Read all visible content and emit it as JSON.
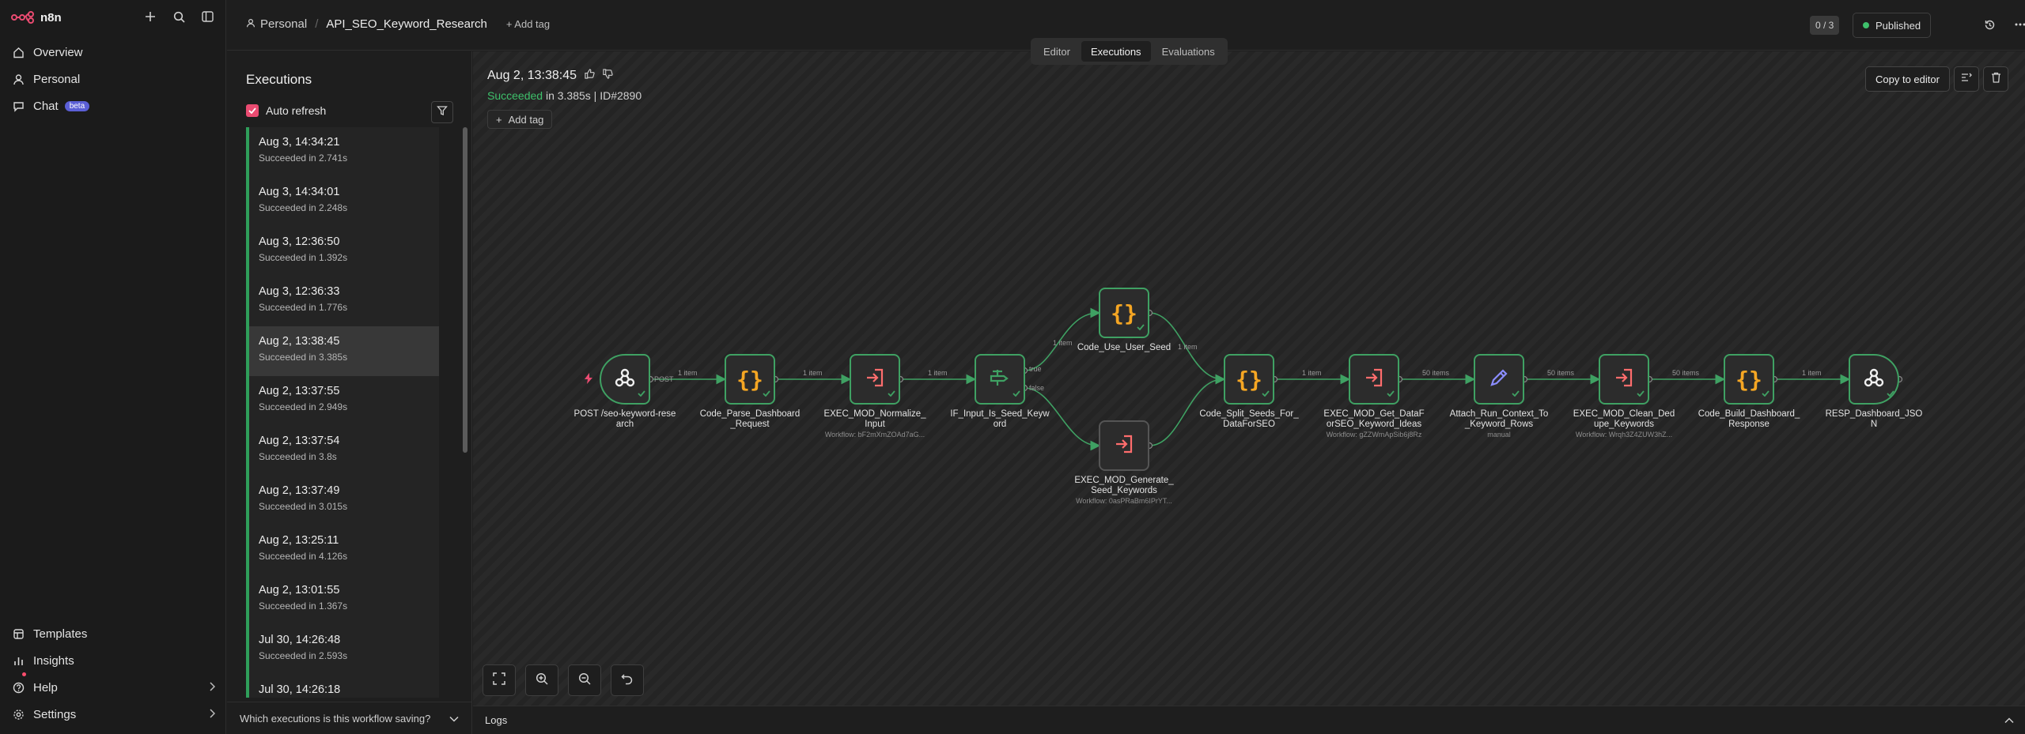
{
  "app": {
    "logo_text": "n8n"
  },
  "sidebar": {
    "top_icons": [
      "plus-icon",
      "search-icon",
      "panel-toggle-icon"
    ],
    "nav": [
      {
        "label": "Overview",
        "icon": "home-icon"
      },
      {
        "label": "Personal",
        "icon": "user-icon"
      },
      {
        "label": "Chat",
        "icon": "chat-icon",
        "badge": "beta"
      }
    ],
    "bottom": [
      {
        "label": "Templates",
        "icon": "templates-icon"
      },
      {
        "label": "Insights",
        "icon": "insights-icon"
      },
      {
        "label": "Help",
        "icon": "help-icon"
      },
      {
        "label": "Settings",
        "icon": "settings-icon"
      }
    ]
  },
  "header": {
    "project": "Personal",
    "workflow_name": "API_SEO_Keyword_Research",
    "add_tag": "+ Add tag",
    "tabs": [
      "Editor",
      "Executions",
      "Evaluations"
    ],
    "active_tab": "Executions",
    "counter": "0 / 3",
    "status": "Published",
    "status_color": "#3ec06b"
  },
  "executions": {
    "title": "Executions",
    "auto_refresh_label": "Auto refresh",
    "auto_refresh": true,
    "list": [
      {
        "date": "Aug 3, 14:34:21",
        "status": "Succeeded in 2.741s"
      },
      {
        "date": "Aug 3, 14:34:01",
        "status": "Succeeded in 2.248s"
      },
      {
        "date": "Aug 3, 12:36:50",
        "status": "Succeeded in 1.392s"
      },
      {
        "date": "Aug 3, 12:36:33",
        "status": "Succeeded in 1.776s"
      },
      {
        "date": "Aug 2, 13:38:45",
        "status": "Succeeded in 3.385s"
      },
      {
        "date": "Aug 2, 13:37:55",
        "status": "Succeeded in 2.949s"
      },
      {
        "date": "Aug 2, 13:37:54",
        "status": "Succeeded in 3.8s"
      },
      {
        "date": "Aug 2, 13:37:49",
        "status": "Succeeded in 3.015s"
      },
      {
        "date": "Aug 2, 13:25:11",
        "status": "Succeeded in 4.126s"
      },
      {
        "date": "Aug 2, 13:01:55",
        "status": "Succeeded in 1.367s"
      },
      {
        "date": "Jul 30, 14:26:48",
        "status": "Succeeded in 2.593s"
      },
      {
        "date": "Jul 30, 14:26:18",
        "status": ""
      }
    ],
    "active_index": 4,
    "saving_question": "Which executions is this workflow saving?"
  },
  "detail": {
    "date": "Aug 2, 13:38:45",
    "status_word": "Succeeded",
    "duration": " in 3.385s | ID#2890",
    "add_tag": "Add tag",
    "copy_button": "Copy to editor"
  },
  "nodes": [
    {
      "name": "POST /seo-keyword-research",
      "type": "webhook"
    },
    {
      "name": "Code_Parse_Dashboard_Request",
      "type": "code"
    },
    {
      "name": "EXEC_MOD_Normalize_Input",
      "type": "exec",
      "sub": "Workflow: bF2mXmZOAd7aG..."
    },
    {
      "name": "IF_Input_Is_Seed_Keyword",
      "type": "if"
    },
    {
      "name": "Code_Use_User_Seed",
      "type": "code"
    },
    {
      "name": "EXEC_MOD_Generate_Seed_Keywords",
      "type": "exec",
      "sub": "Workflow: 0asPRaBm6IPrYT..."
    },
    {
      "name": "Code_Split_Seeds_For_DataForSEO",
      "type": "code"
    },
    {
      "name": "EXEC_MOD_Get_DataForSEO_Keyword_Ideas",
      "type": "exec",
      "sub": "Workflow: gZZWmApSib6j8Rz"
    },
    {
      "name": "Attach_Run_Context_To_Keyword_Rows",
      "type": "set",
      "sub": "manual"
    },
    {
      "name": "EXEC_MOD_Clean_Dedupe_Keywords",
      "type": "exec",
      "sub": "Workflow: Wrqh3Z4ZUW3hZ..."
    },
    {
      "name": "Code_Build_Dashboard_Response",
      "type": "code"
    },
    {
      "name": "RESP_Dashboard_JSON",
      "type": "webhook"
    }
  ],
  "edge_labels": {
    "post": "POST",
    "one_item": "1 item",
    "fifty_items": "50 items",
    "true": "true",
    "false": "false"
  },
  "logs": {
    "label": "Logs"
  }
}
